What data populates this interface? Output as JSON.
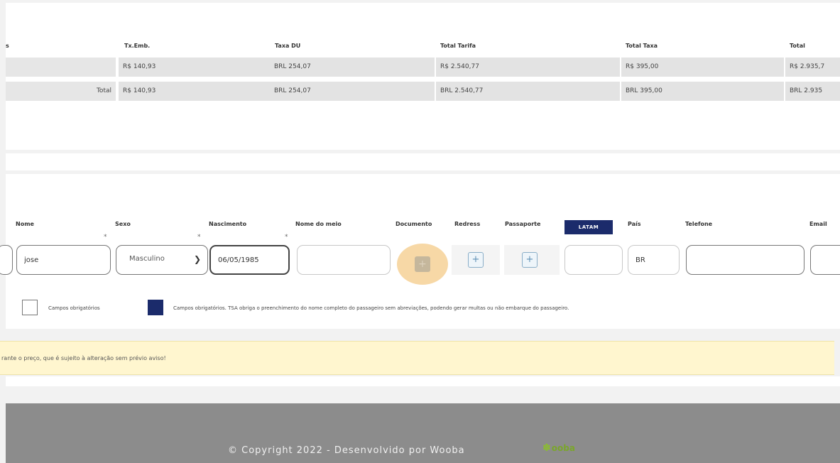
{
  "fare_table": {
    "first_col_partial": "s",
    "headers": [
      "Tx.Emb.",
      "Taxa DU",
      "Total Tarifa",
      "Total Taxa",
      "Total"
    ],
    "rows": [
      {
        "label": "",
        "values": [
          "R$ 140,93",
          "BRL 254,07",
          "R$ 2.540,77",
          "R$ 395,00",
          "R$ 2.935,7"
        ]
      },
      {
        "label": "Total",
        "values": [
          "R$ 140,93",
          "BRL 254,07",
          "BRL 2.540,77",
          "BRL 395,00",
          "BRL 2.935"
        ]
      }
    ]
  },
  "passenger_form": {
    "labels": {
      "nome": "Nome",
      "sexo": "Sexo",
      "nascimento": "Nascimento",
      "nome_meio": "Nome do meio",
      "documento": "Documento",
      "redress": "Redress",
      "passaporte": "Passaporte",
      "pais": "País",
      "telefone": "Telefone",
      "email": "Email"
    },
    "required_mark": "*",
    "values": {
      "nome": "jose",
      "sexo": "Masculino",
      "nascimento": "06/05/1985",
      "nome_meio": "",
      "loyalty": "",
      "pais": "BR",
      "telefone": "",
      "email": ""
    },
    "loyalty_brand": "LATAM",
    "add_symbol": "+",
    "legend": {
      "required": "Campos obrigatórios",
      "tsa": "Campos obrigatórios. TSA obriga o preenchimento do nome completo do passageiro sem abreviações, podendo gerar multas ou não embarque do passageiro."
    }
  },
  "notice": {
    "text": "rante o preço, que é sujeito à alteração sem prévio aviso!"
  },
  "footer": {
    "copyright": "© Copyright 2022 - Desenvolvido por Wooba",
    "logo": "ooba"
  },
  "colors": {
    "tsa_required": "#1b2b6b",
    "latam_badge": "#1b2b6b",
    "focus_ring": "#f7d8a6",
    "notice_bg": "#fff6cf",
    "footer_bg": "#8c8c8c"
  },
  "icons": [
    "plus-icon",
    "chevron-down-icon",
    "wooba-logo-icon"
  ]
}
